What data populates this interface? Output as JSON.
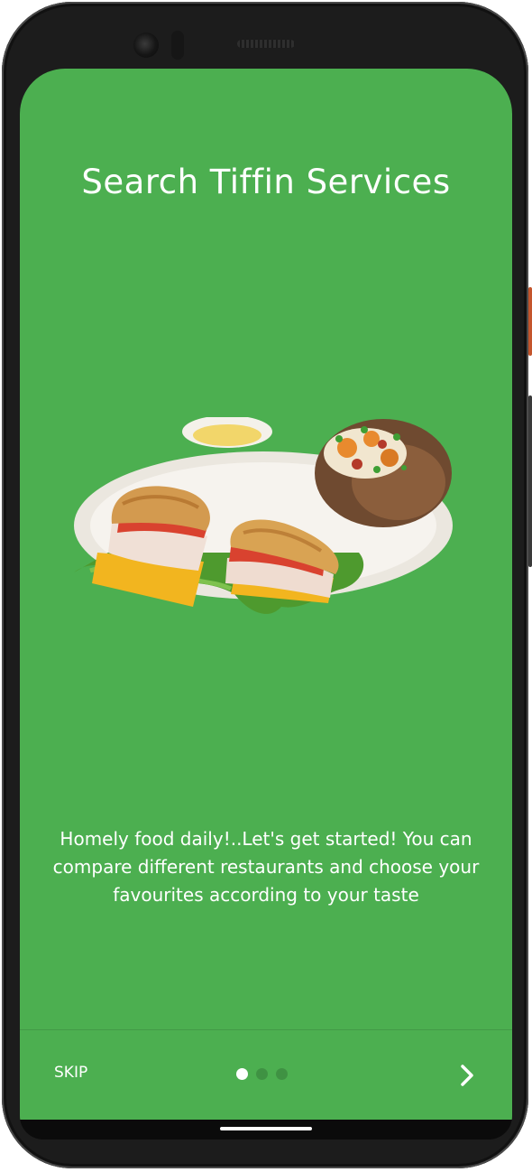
{
  "onboarding": {
    "title": "Search Tiffin Services",
    "image_description": "food-plate-illustration",
    "description": "Homely food daily!..Let's get started! You can compare different restaurants and choose your favourites according to your taste"
  },
  "footer": {
    "skip_label": "SKIP",
    "page_count": 3,
    "current_page": 1,
    "next_icon": "chevron-right-icon"
  },
  "colors": {
    "background": "#4caf50",
    "text": "#ffffff",
    "dot_active": "#ffffff",
    "dot_inactive": "rgba(0,0,0,0.16)"
  }
}
